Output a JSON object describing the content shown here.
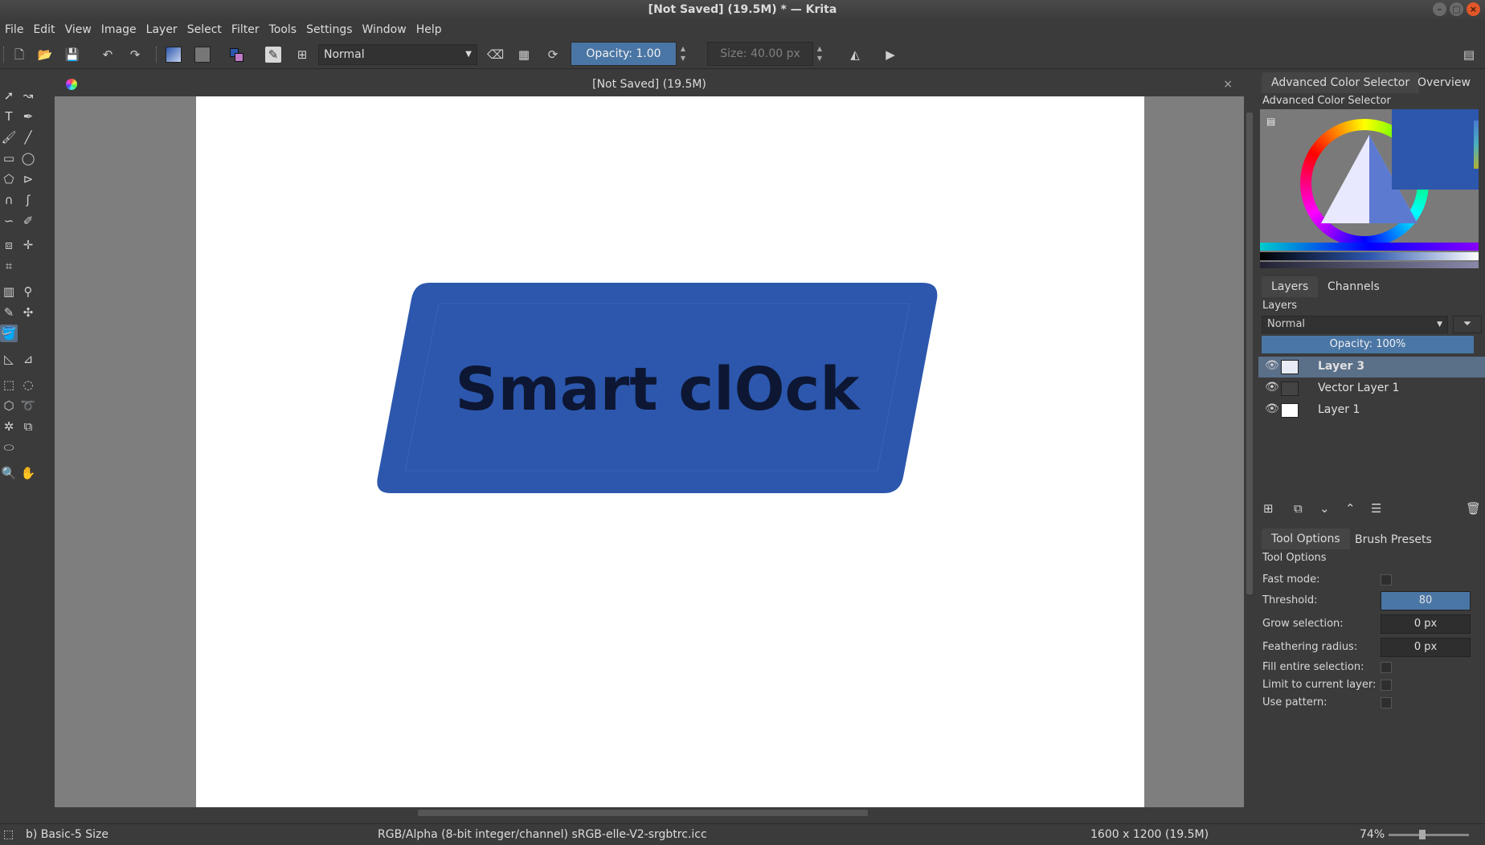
{
  "window": {
    "title": "[Not Saved]  (19.5M) * — Krita",
    "minimize": "–",
    "maximize": "□",
    "close": "×"
  },
  "menubar": [
    "File",
    "Edit",
    "View",
    "Image",
    "Layer",
    "Select",
    "Filter",
    "Tools",
    "Settings",
    "Window",
    "Help"
  ],
  "toolbar": {
    "blend_mode": "Normal",
    "opacity_label": "Opacity:  1.00",
    "size_label": "Size:  40.00 px"
  },
  "document": {
    "tab_title": "[Not Saved]  (19.5M)",
    "close": "×",
    "artwork_text": "Smart clOck",
    "artwork_color": "#2c57ad",
    "artwork_text_color": "#0d1733"
  },
  "dockers": {
    "color_tabs": [
      "Advanced Color Selector",
      "Overview"
    ],
    "color_title": "Advanced Color Selector",
    "current_color": "#2c57ad",
    "layer_tabs": [
      "Layers",
      "Channels"
    ],
    "layers_title": "Layers",
    "layer_blend": "Normal",
    "layer_opacity": "Opacity:  100%",
    "layers": [
      {
        "name": "Layer 3",
        "selected": true
      },
      {
        "name": "Vector Layer 1",
        "selected": false
      },
      {
        "name": "Layer 1",
        "selected": false
      }
    ],
    "option_tabs": [
      "Tool Options",
      "Brush Presets"
    ],
    "options_title": "Tool Options",
    "options": {
      "fast_mode": "Fast mode:",
      "threshold_label": "Threshold:",
      "threshold_value": "80",
      "grow_label": "Grow selection:",
      "grow_value": "0 px",
      "feather_label": "Feathering radius:",
      "feather_value": "0 px",
      "fill_entire": "Fill entire selection:",
      "limit_layer": "Limit to current layer:",
      "use_pattern": "Use pattern:"
    }
  },
  "statusbar": {
    "brush": "b) Basic-5 Size",
    "color_space": "RGB/Alpha (8-bit integer/channel)  sRGB-elle-V2-srgbtrc.icc",
    "dimensions": "1600 x 1200 (19.5M)",
    "zoom": "74%"
  }
}
